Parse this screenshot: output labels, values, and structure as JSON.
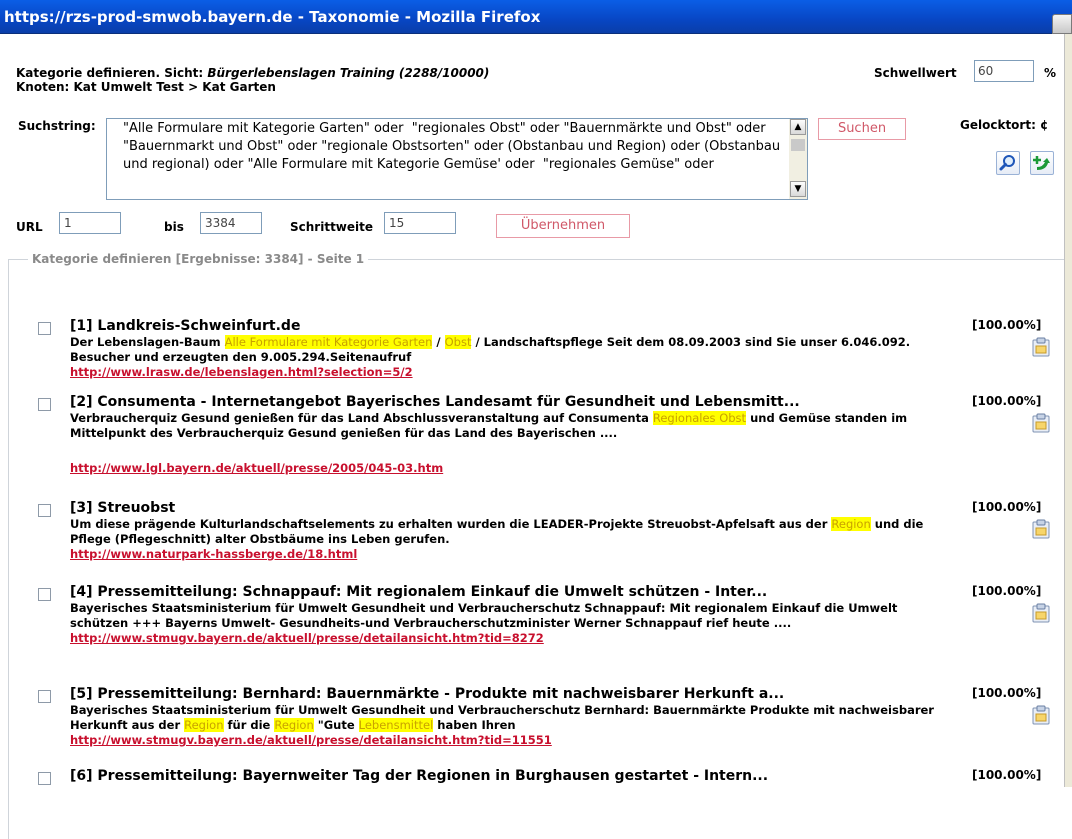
{
  "window": {
    "title": "https://rzs-prod-smwob.bayern.de - Taxonomie - Mozilla Firefox"
  },
  "header": {
    "line1_prefix": "Kategorie definieren. Sicht: ",
    "line1_view": "Bürgerlebenslagen Training (2288/10000)",
    "line2": "Knoten: Kat Umwelt Test > Kat Garten",
    "threshold_label": "Schwellwert",
    "threshold_value": "60",
    "threshold_unit": "%"
  },
  "search": {
    "label": "Suchstring:",
    "query": "\"Alle Formulare mit Kategorie Garten\" oder  \"regionales Obst\" oder \"Bauernmärkte und Obst\" oder \"Bauernmarkt und Obst\" oder \"regionale Obstsorten\" oder (Obstanbau und Region) oder (Obstanbau und regional) oder \"Alle Formulare mit Kategorie Gemüse' oder  \"regionales Gemüse\" oder",
    "submit_label": "Suchen",
    "side_label": "Gelocktort: ¢"
  },
  "range": {
    "url_label": "URL",
    "url_value": "1",
    "bis_label": "bis",
    "bis_value": "3384",
    "step_label": "Schrittweite",
    "step_value": "15",
    "apply_label": "Übernehmen"
  },
  "results_legend": "Kategorie definieren [Ergebnisse: 3384] - Seite 1",
  "results": [
    {
      "title": "[1] Landkreis-Schweinfurt.de",
      "score": "[100.00%]",
      "desc": [
        {
          "t": "Der Lebenslagen-Baum "
        },
        {
          "t": "Alle Formulare mit Kategorie Garten",
          "hl": true
        },
        {
          "t": " / "
        },
        {
          "t": "Obst",
          "hl": true
        },
        {
          "t": " / Landschaftspflege Seit dem 08.09.2003 sind Sie unser 6.046.092. Besucher und erzeugten den 9.005.294.Seitenaufruf"
        }
      ],
      "url": "http://www.lrasw.de/lebenslagen.html?selection=5/2"
    },
    {
      "title": "[2] Consumenta - Internetangebot Bayerisches Landesamt für Gesundheit und Lebensmitt...",
      "score": "[100.00%]",
      "desc": [
        {
          "t": "Verbraucherquiz Gesund genießen für das Land Abschlussveranstaltung auf Consumenta "
        },
        {
          "t": "Regionales Obst",
          "hl": true
        },
        {
          "t": " und Gemüse standen im Mittelpunkt des Verbraucherquiz Gesund genießen für das Land des Bayerischen ...."
        }
      ],
      "url": "http://www.lgl.bayern.de/aktuell/presse/2005/045-03.htm"
    },
    {
      "title": "[3] Streuobst",
      "score": "[100.00%]",
      "desc": [
        {
          "t": "Um diese prägende Kulturlandschaftselements zu erhalten wurden die LEADER-Projekte Streuobst-Apfelsaft aus der "
        },
        {
          "t": "Region",
          "hl": true
        },
        {
          "t": " und die Pflege (Pflegeschnitt) alter Obstbäume ins Leben gerufen."
        }
      ],
      "url": "http://www.naturpark-hassberge.de/18.html"
    },
    {
      "title": "[4] Pressemitteilung: Schnappauf: Mit regionalem Einkauf die Umwelt schützen - Inter...",
      "score": "[100.00%]",
      "desc": [
        {
          "t": "Bayerisches Staatsministerium für Umwelt Gesundheit und Verbraucherschutz Schnappauf: Mit regionalem Einkauf die Umwelt schützen +++ Bayerns Umwelt- Gesundheits-und Verbraucherschutzminister Werner Schnappauf rief heute ...."
        }
      ],
      "url": "http://www.stmugv.bayern.de/aktuell/presse/detailansicht.htm?tid=8272"
    },
    {
      "title": "[5] Pressemitteilung: Bernhard: Bauernmärkte - Produkte mit nachweisbarer Herkunft a...",
      "score": "[100.00%]",
      "desc": [
        {
          "t": "Bayerisches Staatsministerium für Umwelt Gesundheit und Verbraucherschutz Bernhard: Bauernmärkte Produkte mit nachweisbarer Herkunft aus der "
        },
        {
          "t": "Region",
          "hl": true
        },
        {
          "t": " für die "
        },
        {
          "t": "Region",
          "hl": true
        },
        {
          "t": " \"Gute "
        },
        {
          "t": "Lebensmittel",
          "hl": true
        },
        {
          "t": " haben Ihren"
        }
      ],
      "url": "http://www.stmugv.bayern.de/aktuell/presse/detailansicht.htm?tid=11551"
    },
    {
      "title": "[6] Pressemitteilung: Bayernweiter Tag der Regionen in Burghausen gestartet - Intern...",
      "score": "[100.00%]",
      "desc": [],
      "url": ""
    }
  ],
  "icons": {
    "search": "magnifier-icon",
    "add": "add-arrow-icon",
    "clipboard": "clipboard-icon"
  },
  "colors": {
    "titlebar": "#0846c4",
    "link": "#c8102e",
    "highlight": "#ffff00",
    "button_border": "#e89aa6"
  }
}
